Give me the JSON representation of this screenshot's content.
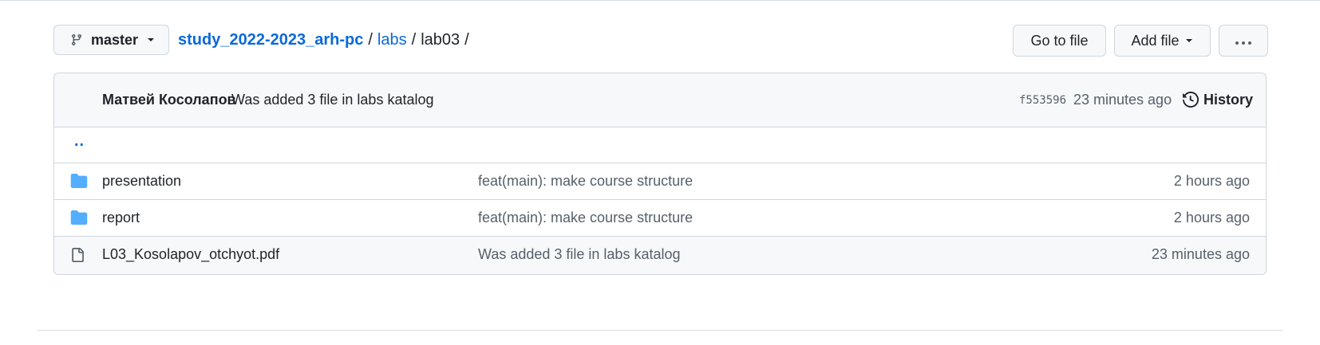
{
  "nav": {
    "branch": "master",
    "breadcrumb": {
      "repo": "study_2022-2023_arh-pc",
      "sep": "/",
      "folder": "labs",
      "current": "lab03"
    },
    "buttons": {
      "go_to_file": "Go to file",
      "add_file": "Add file",
      "more": "···"
    }
  },
  "commit": {
    "author": "Матвей Косолапов",
    "message": "Was added 3 file in labs katalog",
    "sha": "f553596",
    "time": "23 minutes ago",
    "history_label": "History"
  },
  "parent_dir": "..",
  "files": [
    {
      "name": "presentation",
      "type": "folder",
      "commit_message": "feat(main): make course structure",
      "age": "2 hours ago"
    },
    {
      "name": "report",
      "type": "folder",
      "commit_message": "feat(main): make course structure",
      "age": "2 hours ago"
    },
    {
      "name": "L03_Kosolapov_otchyot.pdf",
      "type": "file",
      "commit_message": "Was added 3 file in labs katalog",
      "age": "23 minutes ago"
    }
  ],
  "colors": {
    "link": "#0969da",
    "folder_icon": "#54aeff",
    "muted_text": "#57606a",
    "border": "#d0d7de",
    "header_bg": "#f6f8fa"
  }
}
